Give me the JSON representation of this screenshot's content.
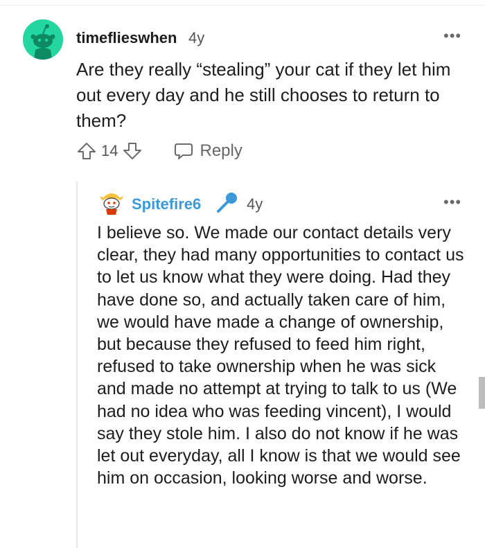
{
  "comment": {
    "username": "timeflieswhen",
    "age": "4y",
    "body": "Are they really “stealing” your cat if they let him out every day and he still chooses to return to them?",
    "vote_count": "14",
    "reply_label": "Reply",
    "more_glyph": "•••",
    "avatar_color": "#24d6a0"
  },
  "reply": {
    "username": "Spitefire6",
    "age": "4y",
    "more_glyph": "•••",
    "username_color": "#3a9ad9",
    "body": "I believe so. We made our contact details very clear, they had many opportunities to contact us to let us know what they were doing. Had they have done so, and actually taken care of him, we would have made a change of ownership, but because they refused to feed him right, refused to take ownership when he was sick and made no attempt at trying to talk to us (We had no idea who was feeding vincent), I would say they stole him. I also do not know if he was let out everyday, all I know is that we would see him on occasion, looking worse and worse."
  },
  "icons": {
    "upvote": "upvote-icon",
    "downvote": "downvote-icon",
    "reply": "chat-bubble-icon",
    "mic": "microphone-icon",
    "more": "more-options-icon"
  }
}
